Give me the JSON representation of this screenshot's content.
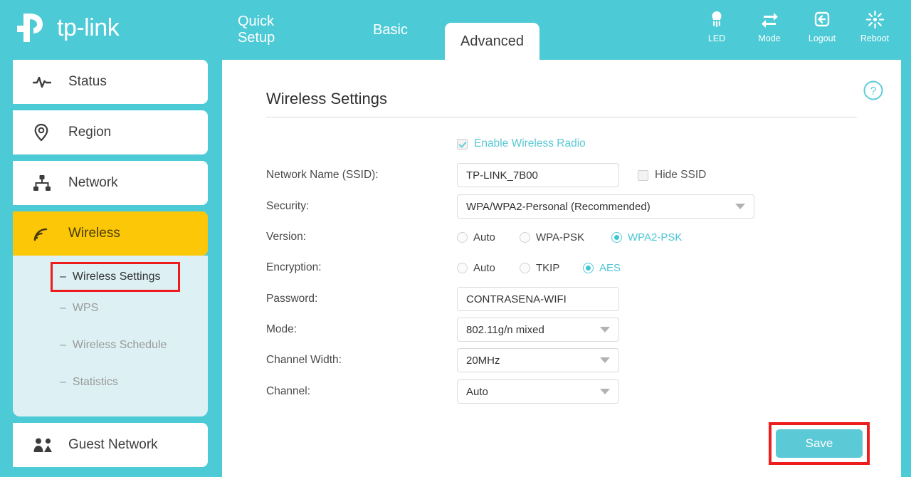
{
  "brand": {
    "name": "tp-link",
    "logo_icon": "tp-link-logo-icon"
  },
  "colors": {
    "teal": "#4ccad6",
    "teal_accent": "#5cc9d6",
    "yellow": "#fbc707",
    "submenu_bg": "#ddf1f4",
    "annotation_red": "#ee1c1c"
  },
  "tabs": [
    {
      "label": "Quick Setup",
      "active": false
    },
    {
      "label": "Basic",
      "active": false
    },
    {
      "label": "Advanced",
      "active": true
    }
  ],
  "header_icons": [
    {
      "label": "LED",
      "icon": "led-bulb-icon"
    },
    {
      "label": "Mode",
      "icon": "swap-arrows-icon"
    },
    {
      "label": "Logout",
      "icon": "logout-arrow-icon"
    },
    {
      "label": "Reboot",
      "icon": "reboot-burst-icon"
    }
  ],
  "sidebar": {
    "items": [
      {
        "label": "Status",
        "icon": "pulse-icon",
        "selected": false
      },
      {
        "label": "Region",
        "icon": "location-pin-icon",
        "selected": false
      },
      {
        "label": "Network",
        "icon": "network-tree-icon",
        "selected": false
      },
      {
        "label": "Wireless",
        "icon": "wifi-signal-icon",
        "selected": true
      },
      {
        "label": "Guest Network",
        "icon": "guest-users-icon",
        "selected": false
      }
    ],
    "submenu": [
      {
        "label": "Wireless Settings",
        "active": true,
        "highlighted": true
      },
      {
        "label": "WPS",
        "active": false,
        "highlighted": false
      },
      {
        "label": "Wireless Schedule",
        "active": false,
        "highlighted": false
      },
      {
        "label": "Statistics",
        "active": false,
        "highlighted": false
      }
    ]
  },
  "content": {
    "page_title": "Wireless Settings",
    "help_icon": "help-question-icon",
    "enable_radio": {
      "label": "Enable Wireless Radio",
      "checked": true
    },
    "fields": {
      "ssid": {
        "label": "Network Name (SSID):",
        "value": "TP-LINK_7B00",
        "placeholder": "",
        "hide_ssid": {
          "label": "Hide SSID",
          "checked": false
        }
      },
      "security": {
        "label": "Security:",
        "value": "WPA/WPA2-Personal (Recommended)"
      },
      "version": {
        "label": "Version:",
        "options": [
          {
            "label": "Auto",
            "selected": false
          },
          {
            "label": "WPA-PSK",
            "selected": false
          },
          {
            "label": "WPA2-PSK",
            "selected": true
          }
        ]
      },
      "encryption": {
        "label": "Encryption:",
        "options": [
          {
            "label": "Auto",
            "selected": false
          },
          {
            "label": "TKIP",
            "selected": false
          },
          {
            "label": "AES",
            "selected": true
          }
        ]
      },
      "password": {
        "label": "Password:",
        "value": "CONTRASENA-WIFI",
        "placeholder": ""
      },
      "mode": {
        "label": "Mode:",
        "value": "802.11g/n mixed"
      },
      "channel_width": {
        "label": "Channel Width:",
        "value": "20MHz"
      },
      "channel": {
        "label": "Channel:",
        "value": "Auto"
      }
    },
    "save_label": "Save"
  }
}
